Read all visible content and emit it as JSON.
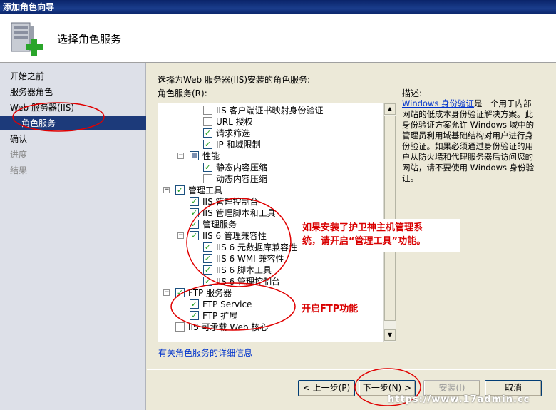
{
  "window": {
    "title": "添加角色向导"
  },
  "header": {
    "title": "选择角色服务",
    "icon": "server-role-add-icon"
  },
  "nav": {
    "items": [
      {
        "label": "开始之前",
        "state": "normal"
      },
      {
        "label": "服务器角色",
        "state": "normal"
      },
      {
        "label": "Web 服务器(IIS)",
        "state": "normal"
      },
      {
        "label": "角色服务",
        "state": "selected"
      },
      {
        "label": "确认",
        "state": "normal"
      },
      {
        "label": "进度",
        "state": "disabled"
      },
      {
        "label": "结果",
        "state": "disabled"
      }
    ]
  },
  "main": {
    "instruction": "选择为Web 服务器(IIS)安装的角色服务:",
    "tree_label": "角色服务(R):",
    "tree": [
      {
        "label": "IIS 客户端证书映射身份验证",
        "state": "unchecked",
        "level": 2
      },
      {
        "label": "URL 授权",
        "state": "unchecked",
        "level": 2
      },
      {
        "label": "请求筛选",
        "state": "checked",
        "level": 2
      },
      {
        "label": "IP 和域限制",
        "state": "checked",
        "level": 2
      },
      {
        "label": "性能",
        "state": "partial",
        "level": 1,
        "expander": "minus"
      },
      {
        "label": "静态内容压缩",
        "state": "checked",
        "level": 2
      },
      {
        "label": "动态内容压缩",
        "state": "unchecked",
        "level": 2
      },
      {
        "label": "管理工具",
        "state": "checked",
        "level": 0,
        "expander": "minus"
      },
      {
        "label": "IIS 管理控制台",
        "state": "checked",
        "level": 1
      },
      {
        "label": "IIS 管理脚本和工具",
        "state": "checked",
        "level": 1
      },
      {
        "label": "管理服务",
        "state": "checked",
        "level": 1
      },
      {
        "label": "IIS 6 管理兼容性",
        "state": "checked",
        "level": 1,
        "expander": "minus"
      },
      {
        "label": "IIS 6 元数据库兼容性",
        "state": "checked",
        "level": 2
      },
      {
        "label": "IIS 6 WMI 兼容性",
        "state": "checked",
        "level": 2
      },
      {
        "label": "IIS 6 脚本工具",
        "state": "checked",
        "level": 2
      },
      {
        "label": "IIS 6 管理控制台",
        "state": "checked",
        "level": 2
      },
      {
        "label": "FTP 服务器",
        "state": "checked",
        "level": 0,
        "expander": "minus"
      },
      {
        "label": "FTP Service",
        "state": "checked",
        "level": 1
      },
      {
        "label": "FTP 扩展",
        "state": "checked",
        "level": 1
      },
      {
        "label": "IIS 可承载 Web 核心",
        "state": "unchecked",
        "level": 0
      }
    ],
    "more_info_link": "有关角色服务的详细信息",
    "description": {
      "title": "描述:",
      "link": "Windows 身份验证",
      "text": "是一个用于内部网站的低成本身份验证解决方案。此身份验证方案允许 Windows 域中的管理员利用域基础结构对用户进行身份验证。如果必须通过身份验证的用户从防火墙和代理服务器后访问您的网站，请不要使用 Windows 身份验证。"
    }
  },
  "annotations": {
    "mgmt_line1": "如果安装了护卫神主机管理系",
    "mgmt_line2": "统，请开启“管理工具”功能。",
    "ftp": "开启FTP功能"
  },
  "buttons": {
    "prev": "< 上一步(P)",
    "next": "下一步(N) >",
    "install": "安装(I)",
    "cancel": "取消"
  },
  "watermark": "https://www.17admin.cc",
  "colors": {
    "selected_nav": "#1c3a7a",
    "annotation": "#d90000",
    "link": "#0033cc"
  }
}
